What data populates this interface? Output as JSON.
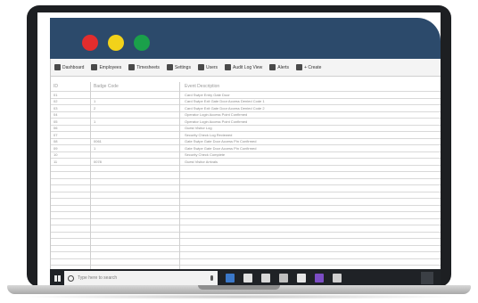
{
  "toolbar": {
    "items": [
      {
        "label": "Dashboard",
        "icon": "dashboard-icon"
      },
      {
        "label": "Employees",
        "icon": "employees-icon"
      },
      {
        "label": "Timesheets",
        "icon": "timesheets-icon"
      },
      {
        "label": "Settings",
        "icon": "settings-icon"
      },
      {
        "label": "Users",
        "icon": "users-icon"
      },
      {
        "label": "Audit Log View",
        "icon": "audit-log-icon"
      },
      {
        "label": "Alerts",
        "icon": "alerts-icon"
      },
      {
        "label": "+ Create",
        "icon": "create-icon"
      }
    ]
  },
  "table": {
    "headers": [
      "ID",
      "Badge Code",
      "Event Description"
    ],
    "rows": [
      [
        "01",
        "",
        "Card Swipe Entry Gate Door"
      ],
      [
        "02",
        "1",
        "Card Swipe Exit Gate Door Access Denied Code 1"
      ],
      [
        "03",
        "2",
        "Card Swipe Exit Gate Door Access Denied Code 2"
      ],
      [
        "04",
        "",
        "Operator Login Access Point Confirmed"
      ],
      [
        "05",
        "1",
        "Operator Login Access Point Confirmed"
      ],
      [
        "06",
        "",
        "Guest Visitor Log"
      ],
      [
        "07",
        "",
        "Security Check Log Reviewed"
      ],
      [
        "08",
        "0061",
        "Gate Swipe Gate Door Access Pin Confirmed"
      ],
      [
        "09",
        "1",
        "Gate Swipe Gate Door Access Pin Confirmed"
      ],
      [
        "10",
        "",
        "Security Check Complete"
      ],
      [
        "11",
        "0078",
        "Guest Visitor Arrivals"
      ]
    ]
  },
  "taskbar": {
    "search_placeholder": "Type here to search"
  },
  "colors": {
    "header_blue": "#2c4a6b",
    "dot_red": "#e32d2d",
    "dot_yellow": "#f2d21a",
    "dot_green": "#1aa04a"
  }
}
